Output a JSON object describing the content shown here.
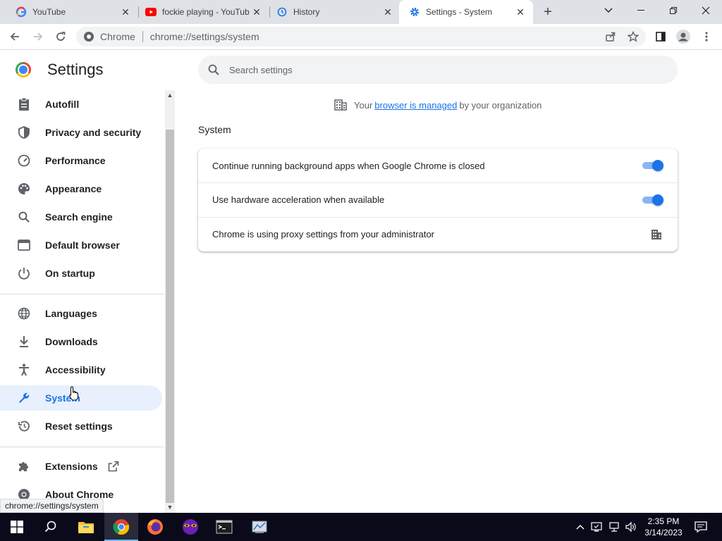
{
  "tabs": [
    {
      "title": "YouTube",
      "icon": "google-g-icon"
    },
    {
      "title": "fockie playing - YouTub",
      "icon": "youtube-icon"
    },
    {
      "title": "History",
      "icon": "history-icon"
    },
    {
      "title": "Settings - System",
      "icon": "settings-gear-icon",
      "active": true
    }
  ],
  "toolbar": {
    "site_label": "Chrome",
    "url": "chrome://settings/system"
  },
  "sidebar": {
    "title": "Settings",
    "items": [
      {
        "label": "Autofill",
        "icon": "clipboard-icon"
      },
      {
        "label": "Privacy and security",
        "icon": "shield-icon"
      },
      {
        "label": "Performance",
        "icon": "speedometer-icon"
      },
      {
        "label": "Appearance",
        "icon": "palette-icon"
      },
      {
        "label": "Search engine",
        "icon": "search-icon"
      },
      {
        "label": "Default browser",
        "icon": "browser-window-icon"
      },
      {
        "label": "On startup",
        "icon": "power-icon"
      },
      {
        "label": "Languages",
        "icon": "globe-icon"
      },
      {
        "label": "Downloads",
        "icon": "download-icon"
      },
      {
        "label": "Accessibility",
        "icon": "accessibility-icon"
      },
      {
        "label": "System",
        "icon": "wrench-icon",
        "active": true
      },
      {
        "label": "Reset settings",
        "icon": "reset-history-icon"
      },
      {
        "label": "Extensions",
        "icon": "puzzle-icon"
      },
      {
        "label": "About Chrome",
        "icon": "chrome-icon"
      }
    ]
  },
  "search": {
    "placeholder": "Search settings"
  },
  "managed": {
    "prefix": "Your",
    "link": "browser is managed",
    "suffix": "by your organization"
  },
  "system": {
    "section_title": "System",
    "rows": [
      {
        "label": "Continue running background apps when Google Chrome is closed",
        "toggle_on": true
      },
      {
        "label": "Use hardware acceleration when available",
        "toggle_on": true
      },
      {
        "label": "Chrome is using proxy settings from your administrator",
        "icon": "enterprise-building-icon"
      }
    ]
  },
  "status_url": "chrome://settings/system",
  "taskbar": {
    "time": "2:35 PM",
    "date": "3/14/2023"
  },
  "colors": {
    "accent": "#1a73e8",
    "active_nav_bg": "#e8f0fe",
    "tabstrip_bg": "#dee1e6",
    "taskbar_bg": "#0a0a1a"
  }
}
